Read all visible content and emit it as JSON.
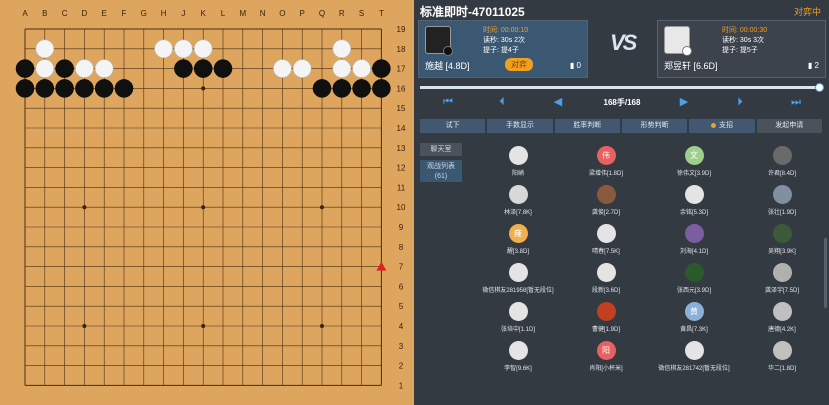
{
  "board": {
    "columns": [
      "A",
      "B",
      "C",
      "D",
      "E",
      "F",
      "G",
      "H",
      "J",
      "K",
      "L",
      "M",
      "N",
      "O",
      "P",
      "Q",
      "R",
      "S",
      "T"
    ],
    "rows": [
      "19",
      "18",
      "17",
      "16",
      "15",
      "14",
      "13",
      "12",
      "11",
      "10",
      "9",
      "8",
      "7",
      "6",
      "5",
      "4",
      "3",
      "2",
      "1"
    ],
    "stones": [
      "...............   ",
      ".W.....WWW......W..",
      "BWBWW...BBB..WW.WWB",
      "BBBBBB.........BBBB",
      "...................",
      "...................",
      "...................",
      "...................",
      "...................",
      "...................",
      "...................",
      "...................",
      "...................",
      "...................",
      "...................",
      "...................",
      "...................",
      "...................",
      "..................."
    ],
    "last_move_marker": "red-triangle",
    "last_move_point": "T7"
  },
  "header": {
    "title": "标准即时-47011025",
    "status": "对弈中"
  },
  "black_player": {
    "time_label": "时间:",
    "time": "00:00:10",
    "byoyomi_label": "读秒:",
    "byoyomi": "30s 2次",
    "handicap_label": "提子:",
    "handicap": "提4子",
    "name": "施越 [4.8D]",
    "badge": "对弈",
    "score": "0"
  },
  "white_player": {
    "time_label": "时间:",
    "time": "00:00:30",
    "byoyomi_label": "读秒:",
    "byoyomi": "30s 3次",
    "handicap_label": "提子:",
    "handicap": "提5子",
    "name": "郑昱轩 [6.6D]",
    "score": "2"
  },
  "vs": "VS",
  "move_count": "168手/168",
  "tabs": [
    "试下",
    "手数显示",
    "胜率判断",
    "形势判断",
    "支招",
    "发起申请"
  ],
  "side_tabs": {
    "chat": "聊天室",
    "viewers": "观战列表",
    "viewer_count": "(61)"
  },
  "viewers": [
    {
      "name": "阳峭",
      "avatar": "",
      "color": "#e4e4e4"
    },
    {
      "name": "梁增伟[1.8D]",
      "avatar": "伟",
      "color": "#e86060"
    },
    {
      "name": "徐伟文[3.9D]",
      "avatar": "文",
      "color": "#9dd08a"
    },
    {
      "name": "许君[8.4D]",
      "avatar": "",
      "color": "#6a6a6a"
    },
    {
      "name": "林泽[7.8K]",
      "avatar": "",
      "color": "#d8d8d8"
    },
    {
      "name": "龚俊[2.7D]",
      "avatar": "",
      "color": "#8a5a3c"
    },
    {
      "name": "余铭[5.3D]",
      "avatar": "",
      "color": "#e4e4e4"
    },
    {
      "name": "张壮[1.9D]",
      "avatar": "",
      "color": "#8090a0"
    },
    {
      "name": "醒[3.8D]",
      "avatar": "雍",
      "color": "#f0b050"
    },
    {
      "name": "晴春[7.5K]",
      "avatar": "",
      "color": "#e4e4e4"
    },
    {
      "name": "刘海[4.1D]",
      "avatar": "",
      "color": "#7b5ea0"
    },
    {
      "name": "吴翔[3.9K]",
      "avatar": "",
      "color": "#3a5a3a"
    },
    {
      "name": "微信棋友281958[暂无段位]",
      "avatar": "",
      "color": "#e4e4e4"
    },
    {
      "name": "段新[3.6D]",
      "avatar": "",
      "color": "#e4e4e4"
    },
    {
      "name": "张西元[3.9D]",
      "avatar": "",
      "color": "#2a5a2a"
    },
    {
      "name": "龚泽宇[7.5D]",
      "avatar": "",
      "color": "#b0b0b0"
    },
    {
      "name": "张培中[1.1D]",
      "avatar": "",
      "color": "#e4e4e4"
    },
    {
      "name": "曹健[1.9D]",
      "avatar": "",
      "color": "#c04020"
    },
    {
      "name": "黄昌[7.3K]",
      "avatar": "黄",
      "color": "#8ab0d8"
    },
    {
      "name": "唐德[4.2K]",
      "avatar": "",
      "color": "#c0c0c0"
    },
    {
      "name": "李智[9.6K]",
      "avatar": "",
      "color": "#e4e4e4"
    },
    {
      "name": "肖阳[小杯米]",
      "avatar": "阳",
      "color": "#e86060"
    },
    {
      "name": "微信棋友281742[暂无段位]",
      "avatar": "",
      "color": "#e4e4e4"
    },
    {
      "name": "华二[1.8D]",
      "avatar": "",
      "color": "#c0c0c0"
    }
  ]
}
